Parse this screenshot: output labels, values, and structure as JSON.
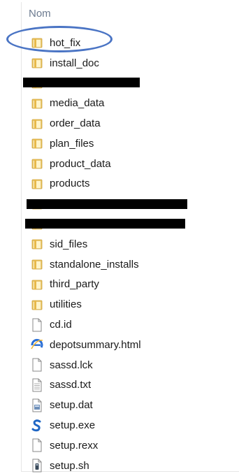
{
  "header": {
    "column_label": "Nom"
  },
  "files": [
    {
      "name": "hot_fix",
      "icon": "folder-icon",
      "highlighted": true
    },
    {
      "name": "install_doc",
      "icon": "folder-icon"
    },
    {
      "name": "",
      "icon": "folder-icon",
      "redacted": true
    },
    {
      "name": "media_data",
      "icon": "folder-icon"
    },
    {
      "name": "order_data",
      "icon": "folder-icon"
    },
    {
      "name": "plan_files",
      "icon": "folder-icon"
    },
    {
      "name": "product_data",
      "icon": "folder-icon"
    },
    {
      "name": "products",
      "icon": "folder-icon"
    },
    {
      "name": "",
      "icon": "folder-icon",
      "redacted": true
    },
    {
      "name": "",
      "icon": "folder-icon",
      "redacted": true
    },
    {
      "name": "sid_files",
      "icon": "folder-icon"
    },
    {
      "name": "standalone_installs",
      "icon": "folder-icon"
    },
    {
      "name": "third_party",
      "icon": "folder-icon"
    },
    {
      "name": "utilities",
      "icon": "folder-icon"
    },
    {
      "name": "cd.id",
      "icon": "blank-file-icon"
    },
    {
      "name": "depotsummary.html",
      "icon": "internet-explorer-html-icon"
    },
    {
      "name": "sassd.lck",
      "icon": "blank-file-icon"
    },
    {
      "name": "sassd.txt",
      "icon": "text-file-icon"
    },
    {
      "name": "setup.dat",
      "icon": "data-file-icon"
    },
    {
      "name": "setup.exe",
      "icon": "sas-executable-icon"
    },
    {
      "name": "setup.rexx",
      "icon": "blank-file-icon"
    },
    {
      "name": "setup.sh",
      "icon": "shell-script-icon"
    }
  ],
  "colors": {
    "folder": "#f0c75e",
    "highlight": "#4a74c4",
    "header_text": "#6b7a8f"
  }
}
